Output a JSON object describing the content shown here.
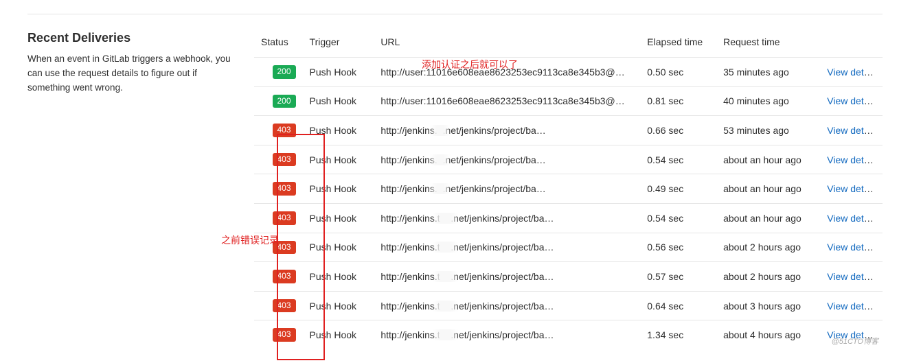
{
  "section": {
    "title": "Recent Deliveries",
    "desc": "When an event in GitLab triggers a webhook, you can use the request details to figure out if something went wrong."
  },
  "headers": {
    "status": "Status",
    "trigger": "Trigger",
    "url": "URL",
    "elapsed": "Elapsed time",
    "request": "Request time"
  },
  "annotations": {
    "url_note": "添加认证之后就可以了",
    "prev_note": "之前错误记录"
  },
  "view_details_label": "View details",
  "watermark": "@51CTO博客",
  "deliveries": [
    {
      "status": "200",
      "status_kind": "success",
      "trigger": "Push Hook",
      "url_a": "http://user:11016e608eae8623253ec9113ca8e345b3@",
      "url_b": "",
      "url_c": "…",
      "elapsed": "0.50 sec",
      "time": "35 minutes ago"
    },
    {
      "status": "200",
      "status_kind": "success",
      "trigger": "Push Hook",
      "url_a": "http://user:11016e608eae8623253ec9113ca8e345b3@",
      "url_b": "",
      "url_c": "…",
      "elapsed": "0.81 sec",
      "time": "40 minutes ago"
    },
    {
      "status": "403",
      "status_kind": "danger",
      "trigger": "Push Hook",
      "url_a": "http://jenkins.",
      "url_b": "   n",
      "url_c": ".net/jenkins/project/ba…",
      "elapsed": "0.66 sec",
      "time": "53 minutes ago"
    },
    {
      "status": "403",
      "status_kind": "danger",
      "trigger": "Push Hook",
      "url_a": "http://jenkins.",
      "url_b": "   n",
      "url_c": ".net/jenkins/project/ba…",
      "elapsed": "0.54 sec",
      "time": "about an hour ago"
    },
    {
      "status": "403",
      "status_kind": "danger",
      "trigger": "Push Hook",
      "url_a": "http://jenkins.",
      "url_b": "   n",
      "url_c": ".net/jenkins/project/ba…",
      "elapsed": "0.49 sec",
      "time": "about an hour ago"
    },
    {
      "status": "403",
      "status_kind": "danger",
      "trigger": "Push Hook",
      "url_a": "http://jenkins.t",
      "url_b": "   on",
      "url_c": ".net/jenkins/project/ba…",
      "elapsed": "0.54 sec",
      "time": "about an hour ago"
    },
    {
      "status": "403",
      "status_kind": "danger",
      "trigger": "Push Hook",
      "url_a": "http://jenkins.t",
      "url_b": "   on",
      "url_c": ".net/jenkins/project/ba…",
      "elapsed": "0.56 sec",
      "time": "about 2 hours ago"
    },
    {
      "status": "403",
      "status_kind": "danger",
      "trigger": "Push Hook",
      "url_a": "http://jenkins.t",
      "url_b": "   on",
      "url_c": ".net/jenkins/project/ba…",
      "elapsed": "0.57 sec",
      "time": "about 2 hours ago"
    },
    {
      "status": "403",
      "status_kind": "danger",
      "trigger": "Push Hook",
      "url_a": "http://jenkins.t",
      "url_b": "   on",
      "url_c": ".net/jenkins/project/ba…",
      "elapsed": "0.64 sec",
      "time": "about 3 hours ago"
    },
    {
      "status": "403",
      "status_kind": "danger",
      "trigger": "Push Hook",
      "url_a": "http://jenkins.t",
      "url_b": "   on",
      "url_c": ".net/jenkins/project/ba…",
      "elapsed": "1.34 sec",
      "time": "about 4 hours ago"
    }
  ]
}
